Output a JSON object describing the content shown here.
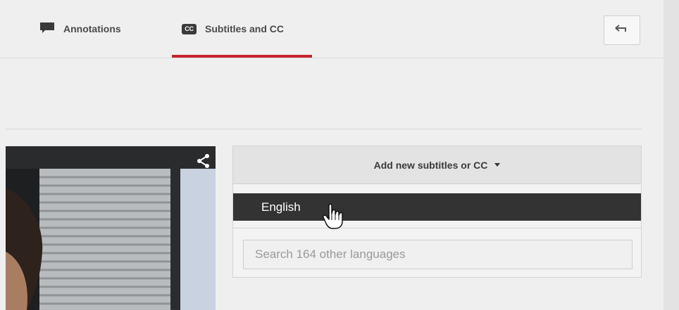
{
  "tabs": [
    {
      "label": "Annotations",
      "icon": "speech-bubble-icon",
      "active": false
    },
    {
      "label": "Subtitles and CC",
      "icon": "cc-icon",
      "icon_text": "CC",
      "active": true
    }
  ],
  "toolbar": {
    "back_icon": "back-arrow-icon"
  },
  "subtitles_panel": {
    "add_button_label": "Add new subtitles or CC",
    "language_options": [
      "English"
    ],
    "search_placeholder": "Search 164 other languages"
  },
  "colors": {
    "accent": "#c8242f",
    "highlight": "#333333"
  }
}
